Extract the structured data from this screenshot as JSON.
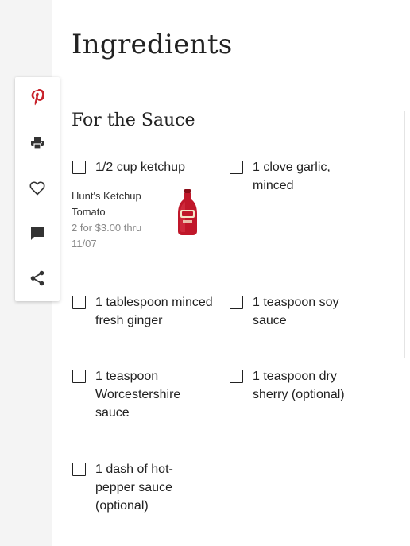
{
  "page": {
    "title": "Ingredients",
    "section_title": "For the Sauce"
  },
  "share_rail": {
    "icons": [
      "pinterest-icon",
      "print-icon",
      "heart-icon",
      "comment-icon",
      "share-icon"
    ],
    "pinterest_color": "#c8232c",
    "icon_color": "#333333"
  },
  "ingredients": [
    {
      "text": "1/2 cup ketchup"
    },
    {
      "text": "1 clove garlic, minced"
    },
    {
      "text": "1 tablespoon minced fresh ginger"
    },
    {
      "text": "1 teaspoon soy sauce"
    },
    {
      "text": "1 teaspoon Worcestershire sauce"
    },
    {
      "text": "1 teaspoon dry sherry (optional)"
    },
    {
      "text": "1 dash of hot-pepper sauce (optional)"
    }
  ],
  "promo": {
    "product_line1": "Hunt's Ketchup",
    "product_line2": "Tomato",
    "deal_line1": "2 for $3.00 thru",
    "deal_line2": "11/07",
    "image": "ketchup-bottle",
    "bottle_color": "#c0172a"
  }
}
